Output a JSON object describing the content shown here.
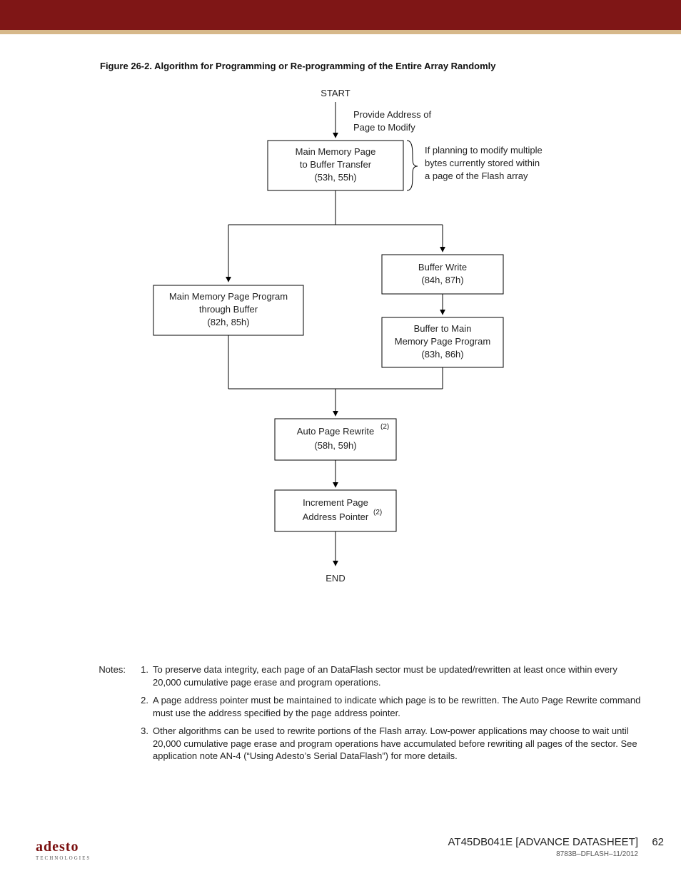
{
  "figure": {
    "label": "Figure 26-2.",
    "title": "Algorithm for Programming or Re-programming of the Entire Array Randomly"
  },
  "flow": {
    "start": "START",
    "end": "END",
    "provide_label_l1": "Provide Address of",
    "provide_label_l2": "Page to Modify",
    "box_transfer_l1": "Main Memory Page",
    "box_transfer_l2": "to Buffer Transfer",
    "box_transfer_l3": "(53h, 55h)",
    "box_program_l1": "Main Memory Page Program",
    "box_program_l2": "through Buffer",
    "box_program_l3": "(82h, 85h)",
    "box_bufwrite_l1": "Buffer Write",
    "box_bufwrite_l2": "(84h, 87h)",
    "box_buf2main_l1": "Buffer to Main",
    "box_buf2main_l2": "Memory Page Program",
    "box_buf2main_l3": "(83h, 86h)",
    "box_autorewrite_l1": "Auto Page Rewrite",
    "box_autorewrite_sup": "(2)",
    "box_autorewrite_l2": "(58h, 59h)",
    "box_incr_l1": "Increment Page",
    "box_incr_l2": "Address Pointer",
    "box_incr_sup": "(2)",
    "side_note_l1": "If planning to modify multiple",
    "side_note_l2": "bytes currently stored within",
    "side_note_l3": "a page of the Flash array"
  },
  "notes": {
    "heading": "Notes:",
    "items": [
      {
        "n": "1.",
        "t": "To preserve data integrity, each page of an DataFlash sector must be updated/rewritten at least once within every 20,000 cumulative page erase and program operations."
      },
      {
        "n": "2.",
        "t": "A page address pointer must be maintained to indicate which page is to be rewritten. The Auto Page Rewrite command must use the address specified by the page address pointer."
      },
      {
        "n": "3.",
        "t": "Other algorithms can be used to rewrite portions of the Flash array. Low-power applications may choose to wait until 20,000 cumulative page erase and program operations have accumulated before rewriting all pages of the sector. See application note AN-4 (“Using Adesto’s Serial DataFlash”) for more details."
      }
    ]
  },
  "footer": {
    "logo_main": "adesto",
    "logo_sub": "TECHNOLOGIES",
    "doc_title": "AT45DB041E [ADVANCE DATASHEET]",
    "doc_meta": "8783B–DFLASH–11/2012",
    "page_no": "62"
  }
}
